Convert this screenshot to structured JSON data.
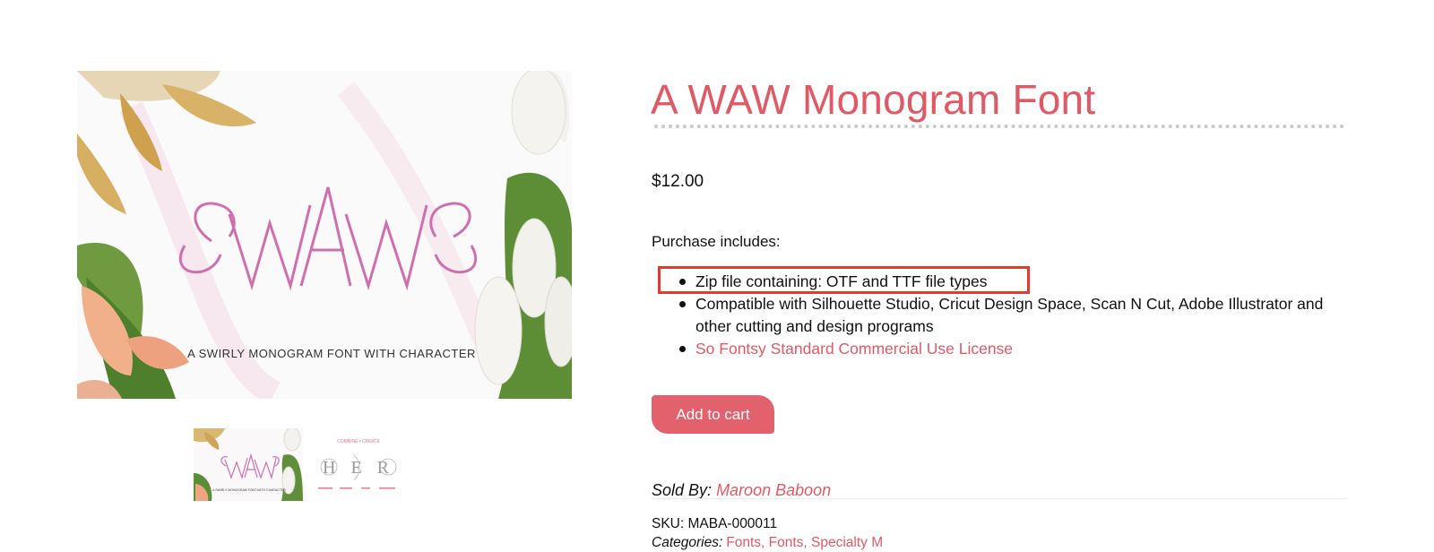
{
  "gallery": {
    "main_image": {
      "monogram_text": "WAW",
      "tagline": "A SWIRLY MONOGRAM FONT WITH CHARACTER"
    },
    "thumbnails": [
      {
        "monogram_text": "WAW",
        "tagline": "A SWIRLY MONOGRAM FONT WITH CHARACTER"
      },
      {
        "top_caption": "COMBINE • CREATE",
        "monogram_text": "H E R"
      }
    ]
  },
  "product": {
    "title": "A WAW Monogram Font",
    "price": "$12.00",
    "purchase_intro": "Purchase includes:",
    "features": [
      "Zip file containing: OTF and TTF file types",
      "Compatible with Silhouette Studio, Cricut Design Space, Scan N Cut, Adobe Illustrator and other cutting and design programs"
    ],
    "license_link": "So Fontsy Standard Commercial Use License",
    "add_to_cart_label": "Add to cart",
    "sold_by_label": "Sold By:",
    "vendor_name": "Maroon Baboon",
    "sku": "SKU: MABA-000011",
    "categories_label": "Categories:",
    "categories_visible": "Fonts, Fonts, Specialty M"
  },
  "colors": {
    "accent": "#e05a66",
    "button": "#e2616c",
    "highlight_border": "#e5392a"
  }
}
